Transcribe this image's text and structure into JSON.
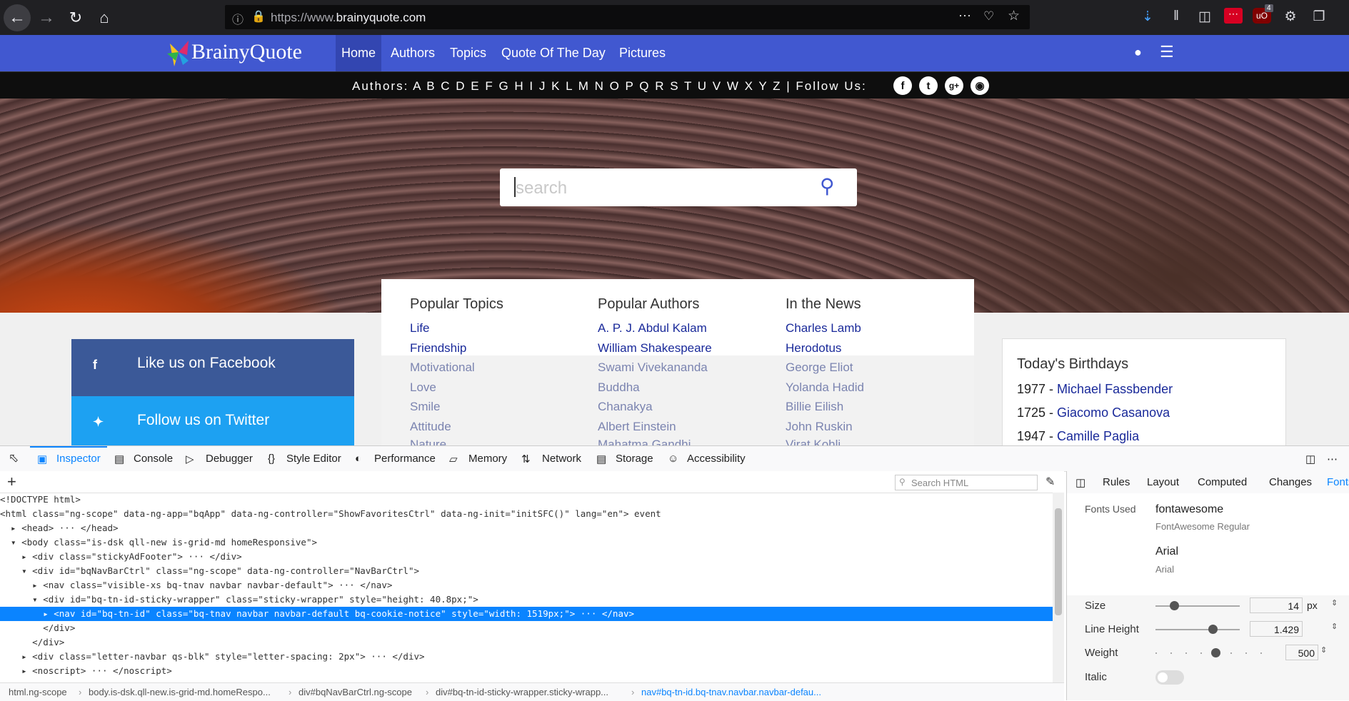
{
  "browser": {
    "url_prefix": "https://www.",
    "url_domain": "brainyquote.com",
    "download_badge": "4"
  },
  "site": {
    "logo": "BrainyQuote",
    "nav": [
      "Home",
      "Authors",
      "Topics",
      "Quote Of The Day",
      "Pictures"
    ],
    "letterbar": {
      "authors_label": "Authors:",
      "letters": "A B C D E F G H I J K L M N O P Q R S T U V W X Y Z",
      "separator": "|",
      "follow_label": "Follow Us:"
    },
    "search_placeholder": "search",
    "popular_topics": {
      "heading": "Popular Topics",
      "items": [
        "Life",
        "Friendship",
        "Motivational",
        "Love",
        "Smile",
        "Attitude",
        "Nature"
      ]
    },
    "popular_authors": {
      "heading": "Popular Authors",
      "items": [
        "A. P. J. Abdul Kalam",
        "William Shakespeare",
        "Swami Vivekananda",
        "Buddha",
        "Chanakya",
        "Albert Einstein",
        "Mahatma Gandhi"
      ]
    },
    "in_the_news": {
      "heading": "In the News",
      "items": [
        "Charles Lamb",
        "Herodotus",
        "George Eliot",
        "Yolanda Hadid",
        "Billie Eilish",
        "John Ruskin",
        "Virat Kohli"
      ]
    },
    "facebook_label": "Like us on Facebook",
    "twitter_label": "Follow us on Twitter",
    "birthdays": {
      "heading": "Today's Birthdays",
      "rows": [
        {
          "year": "1977 - ",
          "name": "Michael Fassbender"
        },
        {
          "year": "1725 - ",
          "name": "Giacomo Casanova"
        },
        {
          "year": "1947 - ",
          "name": "Camille Paglia"
        }
      ]
    }
  },
  "devtools": {
    "tabs": [
      "Inspector",
      "Console",
      "Debugger",
      "Style Editor",
      "Performance",
      "Memory",
      "Network",
      "Storage",
      "Accessibility"
    ],
    "search_placeholder": "Search HTML",
    "markup_lines": [
      "<!DOCTYPE html>",
      "<html class=\"ng-scope\" data-ng-app=\"bqApp\" data-ng-controller=\"ShowFavoritesCtrl\" data-ng-init=\"initSFC()\" lang=\"en\"> event",
      "  ▸ <head> ··· </head>",
      "  ▾ <body class=\"is-dsk qll-new is-grid-md homeResponsive\">",
      "    ▸ <div class=\"stickyAdFooter\"> ··· </div>",
      "    ▾ <div id=\"bqNavBarCtrl\" class=\"ng-scope\" data-ng-controller=\"NavBarCtrl\">",
      "      ▸ <nav class=\"visible-xs bq-tnav navbar navbar-default\"> ··· </nav>",
      "      ▾ <div id=\"bq-tn-id-sticky-wrapper\" class=\"sticky-wrapper\" style=\"height: 40.8px;\">",
      "        ▸ <nav id=\"bq-tn-id\" class=\"bq-tnav navbar navbar-default bq-cookie-notice\" style=\"width: 1519px;\"> ··· </nav>",
      "        </div>",
      "      </div>",
      "    ▸ <div class=\"letter-navbar qs-blk\" style=\"letter-spacing: 2px\"> ··· </div>",
      "    ▸ <noscript> ··· </noscript>"
    ],
    "breadcrumbs": [
      "html.ng-scope",
      "body.is-dsk.qll-new.is-grid-md.homeRespo...",
      "div#bqNavBarCtrl.ng-scope",
      "div#bq-tn-id-sticky-wrapper.sticky-wrapp...",
      "nav#bq-tn-id.bq-tnav.navbar.navbar-defau..."
    ],
    "side_tabs": [
      "Rules",
      "Layout",
      "Computed",
      "Changes",
      "Fonts"
    ],
    "fonts": {
      "used_label": "Fonts Used",
      "font1_name": "fontawesome",
      "font1_sub": "FontAwesome Regular",
      "font2_name": "Arial",
      "font2_sub": "Arial",
      "size_label": "Size",
      "size_value": "14",
      "size_unit": "px",
      "lineheight_label": "Line Height",
      "lineheight_value": "1.429",
      "weight_label": "Weight",
      "weight_value": "500",
      "italic_label": "Italic"
    }
  },
  "colors": {
    "site_nav": "#4158d0",
    "facebook": "#3b5998",
    "twitter": "#1da1f2",
    "devtools_accent": "#0a84ff"
  }
}
